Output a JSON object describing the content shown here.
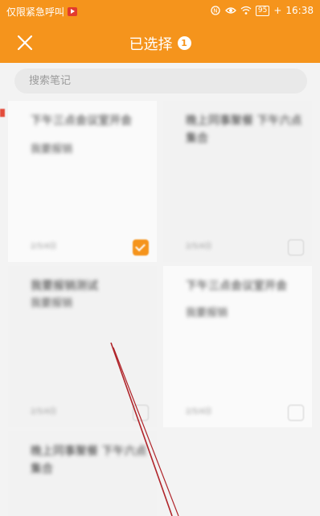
{
  "status_bar": {
    "left_text": "仅限紧急呼叫",
    "battery": "95",
    "time": "16:38",
    "icons": [
      "play-badge-icon",
      "nfc-icon",
      "eye-icon",
      "wifi-icon",
      "battery-icon"
    ]
  },
  "app_bar": {
    "title": "已选择",
    "count": "1",
    "close_icon": "close-icon"
  },
  "search": {
    "placeholder": "搜索笔记"
  },
  "notes": [
    {
      "title": "下午三点会议室开会",
      "body": "我要报销",
      "date": "2/5/4日",
      "checked": true
    },
    {
      "title": "晚上同事聚餐 下午六点集合",
      "body": "",
      "date": "2/5/4日",
      "checked": false
    },
    {
      "title": "我要报销测试",
      "body": "我要报销",
      "date": "2/5/4日",
      "checked": false
    },
    {
      "title": "下午三点会议室开会",
      "body": "我要报销",
      "date": "2/5/4日",
      "checked": false
    },
    {
      "title": "晚上同事聚餐 下午六点集合",
      "body": "",
      "date": "",
      "checked": false
    }
  ],
  "colors": {
    "accent": "#f5941c",
    "annotation_red": "#b0242a"
  }
}
